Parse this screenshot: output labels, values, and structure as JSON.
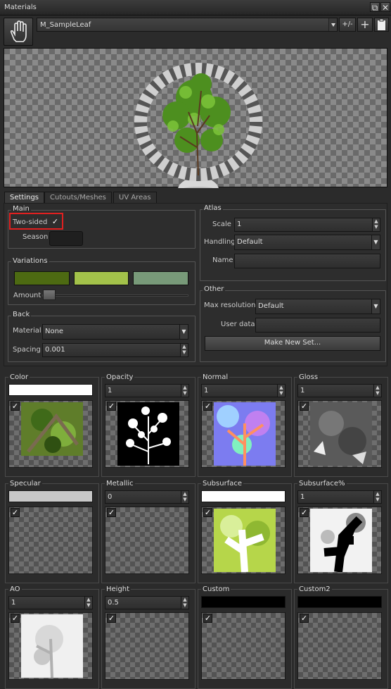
{
  "window": {
    "title": "Materials",
    "restore_icon": "restore-icon",
    "close_icon": "close-icon"
  },
  "toolbar": {
    "material_name": "M_SampleLeaf",
    "plus_minus": "+/-",
    "add_icon": "plus-icon",
    "paste_icon": "clipboard-icon",
    "hand_icon": "hand-icon"
  },
  "tabs": [
    "Settings",
    "Cutouts/Meshes",
    "UV Areas"
  ],
  "main": {
    "title": "Main",
    "two_sided_label": "Two-sided",
    "two_sided_checked": "✓",
    "season_label": "Season"
  },
  "variations": {
    "title": "Variations",
    "colors": [
      "#4d6a12",
      "#a3c24a",
      "#789a79"
    ],
    "amount_label": "Amount"
  },
  "back": {
    "title": "Back",
    "material_label": "Material",
    "material_value": "None",
    "spacing_label": "Spacing",
    "spacing_value": "0.001"
  },
  "atlas": {
    "title": "Atlas",
    "scale_label": "Scale",
    "scale_value": "1",
    "handling_label": "Handling",
    "handling_value": "Default",
    "name_label": "Name",
    "name_value": ""
  },
  "other": {
    "title": "Other",
    "maxres_label": "Max resolution",
    "maxres_value": "Default",
    "userdata_label": "User data",
    "userdata_value": "",
    "make_set_label": "Make New Set..."
  },
  "textures": [
    {
      "label": "Color",
      "value": ""
    },
    {
      "label": "Opacity",
      "value": "1"
    },
    {
      "label": "Normal",
      "value": "1"
    },
    {
      "label": "Gloss",
      "value": "1"
    },
    {
      "label": "Specular",
      "value": ""
    },
    {
      "label": "Metallic",
      "value": "0"
    },
    {
      "label": "Subsurface",
      "value": ""
    },
    {
      "label": "Subsurface%",
      "value": "1"
    },
    {
      "label": "AO",
      "value": "1"
    },
    {
      "label": "Height",
      "value": "0.5"
    },
    {
      "label": "Custom",
      "value": ""
    },
    {
      "label": "Custom2",
      "value": ""
    }
  ],
  "check_glyph": "✓",
  "colors": {
    "highlight": "#e02020",
    "swatch_white": "#ffffff",
    "swatch_gray": "#c8c8c8",
    "swatch_black": "#000000"
  }
}
